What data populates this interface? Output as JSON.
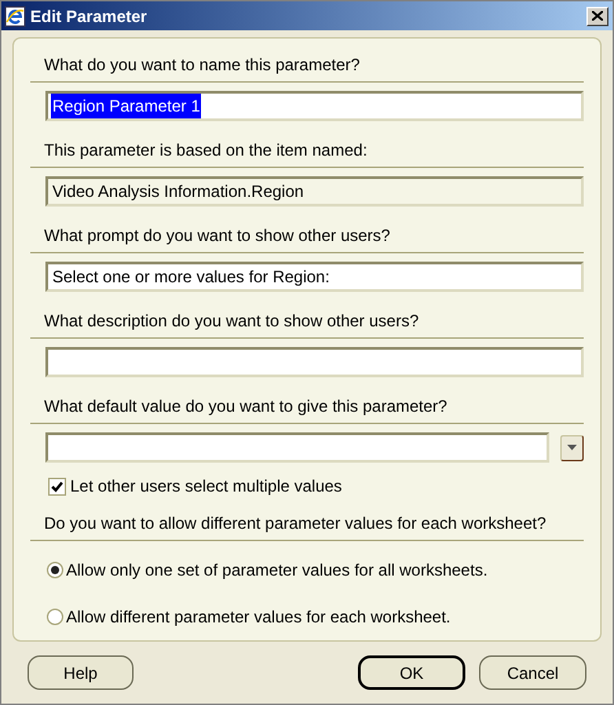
{
  "window": {
    "title": "Edit Parameter"
  },
  "sections": [
    {
      "kind": "text",
      "label": "What do you want to name this parameter?",
      "value": "Region Parameter 1",
      "selected": true,
      "readonly": false
    },
    {
      "kind": "text",
      "label": "This parameter is based on the item named:",
      "value": "Video Analysis Information.Region",
      "selected": false,
      "readonly": true
    },
    {
      "kind": "text",
      "label": "What prompt do you want to show other users?",
      "value": "Select one or more values for Region:",
      "selected": false,
      "readonly": false
    },
    {
      "kind": "text",
      "label": "What description do you want to show other users?",
      "readonly": false
    },
    {
      "kind": "combo",
      "label": "What default value do you want to give this parameter?",
      "readonly": false,
      "checkbox": {
        "label": "Let other users select multiple values",
        "checked": true
      }
    },
    {
      "kind": "radios",
      "label": "Do you want to allow different parameter values for each worksheet?",
      "options": [
        {
          "label": "Allow only one set of parameter values for all worksheets.",
          "selected": true
        },
        {
          "label": "Allow different parameter values for each worksheet.",
          "selected": false
        }
      ]
    }
  ],
  "buttons": [
    {
      "label": "Help",
      "default": false
    },
    {
      "label": "OK",
      "default": true
    },
    {
      "label": "Cancel",
      "default": false
    }
  ]
}
